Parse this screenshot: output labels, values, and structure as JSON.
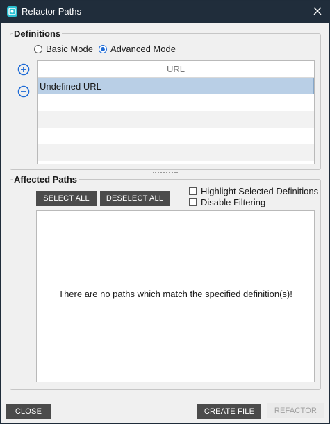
{
  "window": {
    "title": "Refactor Paths"
  },
  "definitions": {
    "label": "Definitions",
    "modes": [
      {
        "label": "Basic Mode",
        "selected": false
      },
      {
        "label": "Advanced Mode",
        "selected": true
      }
    ],
    "table": {
      "header": "URL",
      "rows": [
        "Undefined URL",
        "",
        "",
        "",
        ""
      ],
      "selected_index": 0
    }
  },
  "affected_paths": {
    "label": "Affected Paths",
    "select_all": "SELECT ALL",
    "deselect_all": "DESELECT ALL",
    "options": [
      {
        "label": "Highlight Selected Definitions",
        "checked": false
      },
      {
        "label": "Disable Filtering",
        "checked": false
      }
    ],
    "empty_message": "There are no paths which match the specified definition(s)!"
  },
  "footer": {
    "close": "CLOSE",
    "create_file": "CREATE FILE",
    "refactor": "REFACTOR"
  },
  "colors": {
    "titlebar": "#202d3b",
    "accent": "#1e6bd6",
    "selection": "#b9cfe6",
    "dark_button": "#4b4b4b"
  },
  "icons": [
    "app-icon",
    "close-icon",
    "add-circle-icon",
    "remove-circle-icon"
  ]
}
